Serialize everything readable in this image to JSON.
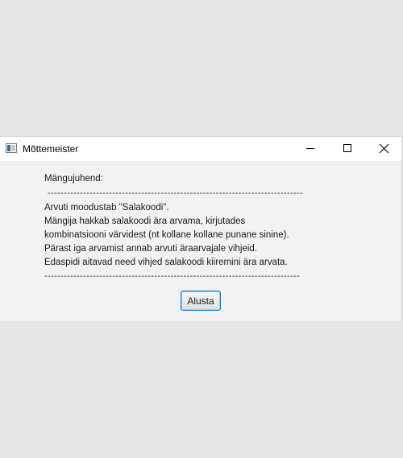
{
  "window": {
    "title": "Mõttemeister",
    "controls": {
      "minimize_icon": "minimize-icon",
      "maximize_icon": "maximize-icon",
      "close_icon": "close-icon"
    }
  },
  "instructions": {
    "heading": "Mängujuhend:",
    "separator_top": "-------------------------------------------------------------------------------",
    "lines": [
      "Arvuti moodustab \"Salakoodi\".",
      "Mängija hakkab salakoodi ära arvama, kirjutades",
      "kombinatsiooni värvidest (nt kollane kollane punane sinine).",
      "Pärast iga arvamist annab arvuti äraarvajale vihjeid.",
      "Edaspidi aitavad need vihjed salakoodi kiiremini ära arvata."
    ],
    "separator_bottom": "-------------------------------------------------------------------------------"
  },
  "actions": {
    "start_label": "Alusta"
  },
  "colors": {
    "desktop_background": "#e6e6e6",
    "window_background": "#f2f2f2",
    "titlebar_background": "#ffffff",
    "button_focus_border": "#0078d4"
  }
}
